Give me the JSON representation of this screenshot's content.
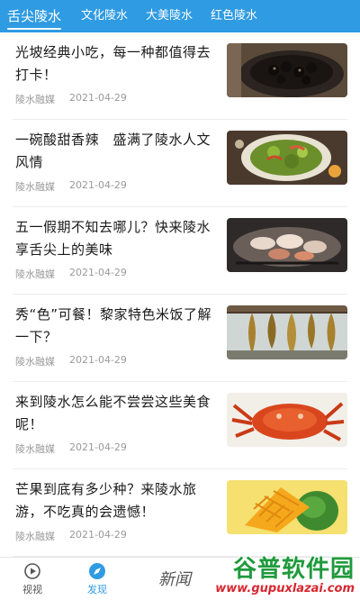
{
  "tabs": [
    {
      "label": "舌尖陵水",
      "active": true
    },
    {
      "label": "文化陵水",
      "active": false
    },
    {
      "label": "大美陵水",
      "active": false
    },
    {
      "label": "红色陵水",
      "active": false
    }
  ],
  "articles": [
    {
      "title": "光坡经典小吃，每一种都值得去打卡！",
      "source": "陵水融媒",
      "date": "2021-04-29",
      "thumb": "dark-snacks-photo"
    },
    {
      "title": "一碗酸甜香辣　盛满了陵水人文风情",
      "source": "陵水融媒",
      "date": "2021-04-29",
      "thumb": "seafood-salad-photo"
    },
    {
      "title": "五一假期不知去哪儿？快来陵水享舌尖上的美味",
      "source": "陵水融媒",
      "date": "2021-04-29",
      "thumb": "grilled-seafood-photo"
    },
    {
      "title": "秀“色”可餐！黎家特色米饭了解一下？",
      "source": "陵水融媒",
      "date": "2021-04-29",
      "thumb": "hanging-rice-photo"
    },
    {
      "title": "来到陵水怎么能不尝尝这些美食呢！",
      "source": "陵水融媒",
      "date": "2021-04-29",
      "thumb": "red-crab-photo"
    },
    {
      "title": "芒果到底有多少种？来陵水旅游，不吃真的会遗憾！",
      "source": "陵水融媒",
      "date": "2021-04-29",
      "thumb": "mango-photo"
    }
  ],
  "bottom_nav": [
    {
      "label": "视视",
      "icon": "video-icon",
      "active": false
    },
    {
      "label": "发现",
      "icon": "compass-icon",
      "active": true
    }
  ],
  "news_logo": "新闻",
  "watermark": {
    "brand": "谷普软件园",
    "url": "www.gupuxlazai.com"
  },
  "colors": {
    "accent": "#2f9be2",
    "watermark_green": "#1f9a3c",
    "watermark_red": "#d8262f"
  }
}
